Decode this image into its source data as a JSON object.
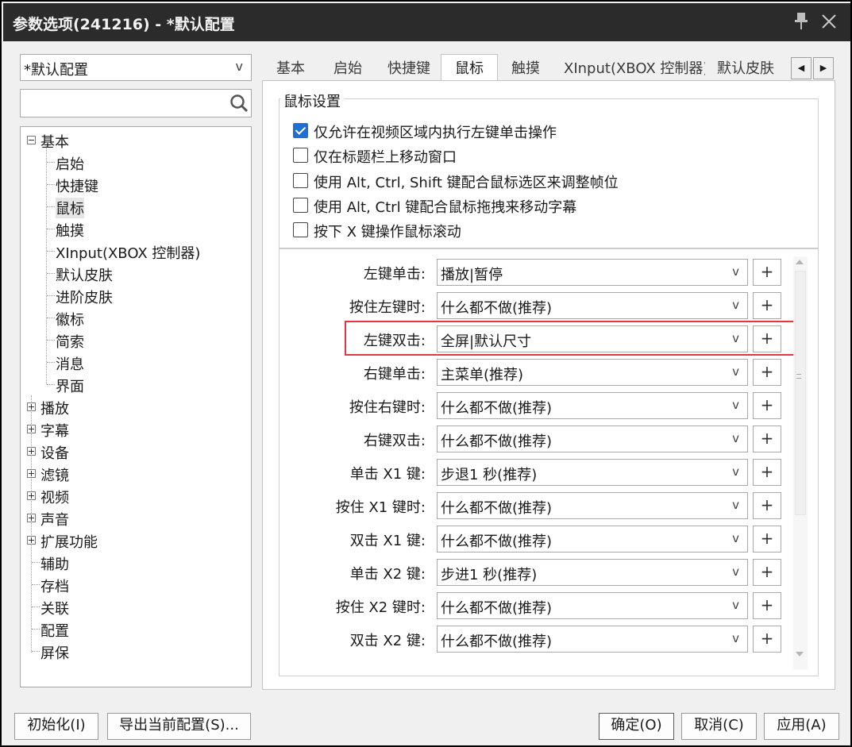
{
  "window": {
    "title": "参数选项(241216) - *默认配置"
  },
  "left": {
    "profile": "*默认配置",
    "search_placeholder": "",
    "tree": [
      {
        "label": "基本",
        "level": 0,
        "expander": "minus"
      },
      {
        "label": "启始",
        "level": 1
      },
      {
        "label": "快捷键",
        "level": 1
      },
      {
        "label": "鼠标",
        "level": 1,
        "selected": true
      },
      {
        "label": "触摸",
        "level": 1
      },
      {
        "label": "XInput(XBOX 控制器)",
        "level": 1
      },
      {
        "label": "默认皮肤",
        "level": 1
      },
      {
        "label": "进阶皮肤",
        "level": 1
      },
      {
        "label": "徽标",
        "level": 1
      },
      {
        "label": "简索",
        "level": 1
      },
      {
        "label": "消息",
        "level": 1
      },
      {
        "label": "界面",
        "level": 1
      },
      {
        "label": "播放",
        "level": 0,
        "expander": "plus"
      },
      {
        "label": "字幕",
        "level": 0,
        "expander": "plus"
      },
      {
        "label": "设备",
        "level": 0,
        "expander": "plus"
      },
      {
        "label": "滤镜",
        "level": 0,
        "expander": "plus"
      },
      {
        "label": "视频",
        "level": 0,
        "expander": "plus"
      },
      {
        "label": "声音",
        "level": 0,
        "expander": "plus"
      },
      {
        "label": "扩展功能",
        "level": 0,
        "expander": "plus"
      },
      {
        "label": "辅助",
        "level": 0
      },
      {
        "label": "存档",
        "level": 0
      },
      {
        "label": "关联",
        "level": 0
      },
      {
        "label": "配置",
        "level": 0
      },
      {
        "label": "屏保",
        "level": 0
      }
    ]
  },
  "tabs": [
    "基本",
    "启始",
    "快捷键",
    "鼠标",
    "触摸",
    "XInput(XBOX 控制器)",
    "默认皮肤"
  ],
  "active_tab": "鼠标",
  "mouse": {
    "group_title": "鼠标设置",
    "checkboxes": [
      {
        "label": "仅允许在视频区域内执行左键单击操作",
        "checked": true
      },
      {
        "label": "仅在标题栏上移动窗口",
        "checked": false
      },
      {
        "label": "使用 Alt, Ctrl, Shift 键配合鼠标选区来调整帧位",
        "checked": false
      },
      {
        "label": "使用 Alt, Ctrl 键配合鼠标拖拽来移动字幕",
        "checked": false
      },
      {
        "label": "按下 X 键操作鼠标滚动",
        "checked": false
      }
    ],
    "bindings": [
      {
        "label": "左键单击:",
        "value": "播放|暂停"
      },
      {
        "label": "按住左键时:",
        "value": "什么都不做(推荐)"
      },
      {
        "label": "左键双击:",
        "value": "全屏|默认尺寸",
        "highlighted": true
      },
      {
        "label": "右键单击:",
        "value": "主菜单(推荐)"
      },
      {
        "label": "按住右键时:",
        "value": "什么都不做(推荐)"
      },
      {
        "label": "右键双击:",
        "value": "什么都不做(推荐)"
      },
      {
        "label": "单击 X1 键:",
        "value": "步退1 秒(推荐)"
      },
      {
        "label": "按住 X1 键时:",
        "value": "什么都不做(推荐)"
      },
      {
        "label": "双击 X1 键:",
        "value": "什么都不做(推荐)"
      },
      {
        "label": "单击 X2 键:",
        "value": "步进1 秒(推荐)"
      },
      {
        "label": "按住 X2 键时:",
        "value": "什么都不做(推荐)"
      },
      {
        "label": "双击 X2 键:",
        "value": "什么都不做(推荐)"
      }
    ],
    "plus_label": "+"
  },
  "footer": {
    "reset": "初始化(I)",
    "export": "导出当前配置(S)...",
    "ok": "确定(O)",
    "cancel": "取消(C)",
    "apply": "应用(A)"
  },
  "colors": {
    "titlebar": "#2b2b2b",
    "checkbox_checked": "#1d6fd3",
    "highlight": "#e0393e"
  }
}
